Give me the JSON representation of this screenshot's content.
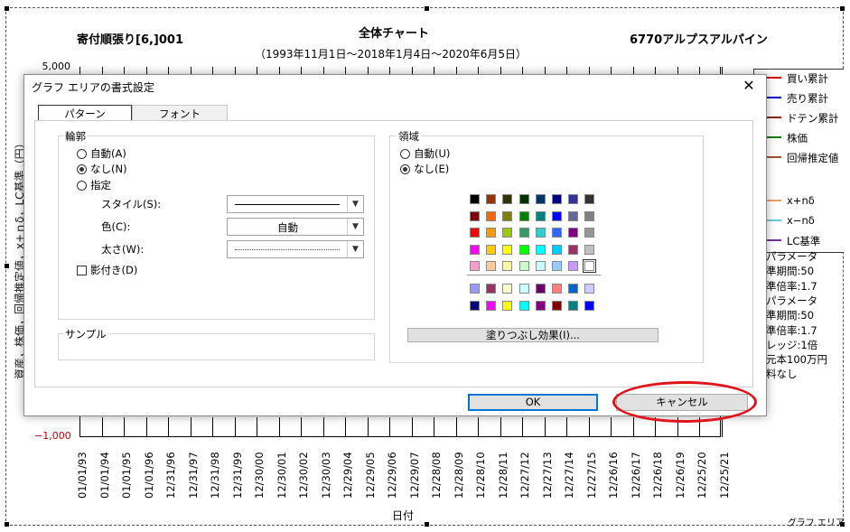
{
  "chart": {
    "title_left": "寄付順張り[6,]001",
    "title_center": "全体チャート",
    "title_right": "6770アルプスアルパイン",
    "subtitle": "（1993年11月1日～2018年1月4日～2020年6月5日）",
    "y_max_label": "5,000",
    "y_min_label": "−1,000",
    "y_min_color": "#c00000",
    "x_axis_label": "日付",
    "y_axis_label": "資産，株価，回帰推定値，x+ｎδ，LC基準（円）",
    "x_ticks": [
      "01/01/93",
      "01/01/94",
      "01/01/95",
      "01/01/96",
      "12/31/96",
      "12/31/97",
      "12/31/98",
      "12/31/99",
      "12/30/00",
      "12/30/01",
      "12/30/02",
      "12/30/03",
      "12/29/04",
      "12/29/05",
      "12/29/06",
      "12/29/07",
      "12/28/08",
      "12/28/09",
      "12/28/10",
      "12/28/11",
      "12/27/12",
      "12/27/13",
      "12/27/14",
      "12/27/15",
      "12/26/16",
      "12/26/17",
      "12/26/18",
      "12/26/19",
      "12/25/20",
      "12/25/21"
    ],
    "legend": [
      {
        "label": "買い累計",
        "color": "#e00000"
      },
      {
        "label": "売り累計",
        "color": "#0000d0"
      },
      {
        "label": "ドテン累計",
        "color": "#8b2500"
      },
      {
        "label": "株価",
        "color": "#008000"
      },
      {
        "label": "回帰推定値",
        "color": "#a0522d"
      },
      {
        "label": "x+nδ",
        "color": "#f0a060"
      },
      {
        "label": "x−nδ",
        "color": "#66ccdd"
      },
      {
        "label": "LC基準",
        "color": "#7030a0"
      }
    ],
    "params": [
      "パラメータ",
      "準期間:50",
      "準倍率:1.7",
      "パラメータ",
      "準期間:50",
      "準倍率:1.7",
      "レッジ:1倍",
      "元本100万円",
      "料なし"
    ],
    "corner_label": "グラフ エリア"
  },
  "dialog": {
    "title": "グラフ エリアの書式設定",
    "close_glyph": "✕",
    "tabs": [
      "パターン",
      "フォント"
    ],
    "border_group": {
      "label": "輪郭",
      "auto": "自動(A)",
      "none": "なし(N)",
      "custom": "指定",
      "style_label": "スタイル(S):",
      "color_label": "色(C):",
      "color_value": "自動",
      "weight_label": "太さ(W):",
      "shadow_label": "影付き(D)"
    },
    "sample_label": "サンプル",
    "area_group": {
      "label": "領域",
      "auto": "自動(U)",
      "none": "なし(E)",
      "fill_effects": "塗りつぶし効果(I)..."
    },
    "palette": [
      [
        "#000000",
        "#993300",
        "#333300",
        "#003300",
        "#003366",
        "#000080",
        "#333399",
        "#333333"
      ],
      [
        "#800000",
        "#ff6600",
        "#808000",
        "#008000",
        "#008080",
        "#0000ff",
        "#666699",
        "#808080"
      ],
      [
        "#ff0000",
        "#ff9900",
        "#99cc00",
        "#339966",
        "#33cccc",
        "#3366ff",
        "#800080",
        "#969696"
      ],
      [
        "#ff00ff",
        "#ffcc00",
        "#ffff00",
        "#00ff00",
        "#00ffff",
        "#00ccff",
        "#993366",
        "#c0c0c0"
      ],
      [
        "#ff99cc",
        "#ffcc99",
        "#ffff99",
        "#ccffcc",
        "#ccffff",
        "#99ccff",
        "#cc99ff",
        "#ffffff"
      ]
    ],
    "palette_extra": [
      [
        "#9999ff",
        "#993366",
        "#ffffcc",
        "#ccffff",
        "#660066",
        "#ff8080",
        "#0066cc",
        "#ccccff"
      ],
      [
        "#000080",
        "#ff00ff",
        "#ffff00",
        "#00ffff",
        "#800080",
        "#800000",
        "#008080",
        "#0000ff"
      ]
    ],
    "ok_label": "OK",
    "cancel_label": "キャンセル"
  }
}
